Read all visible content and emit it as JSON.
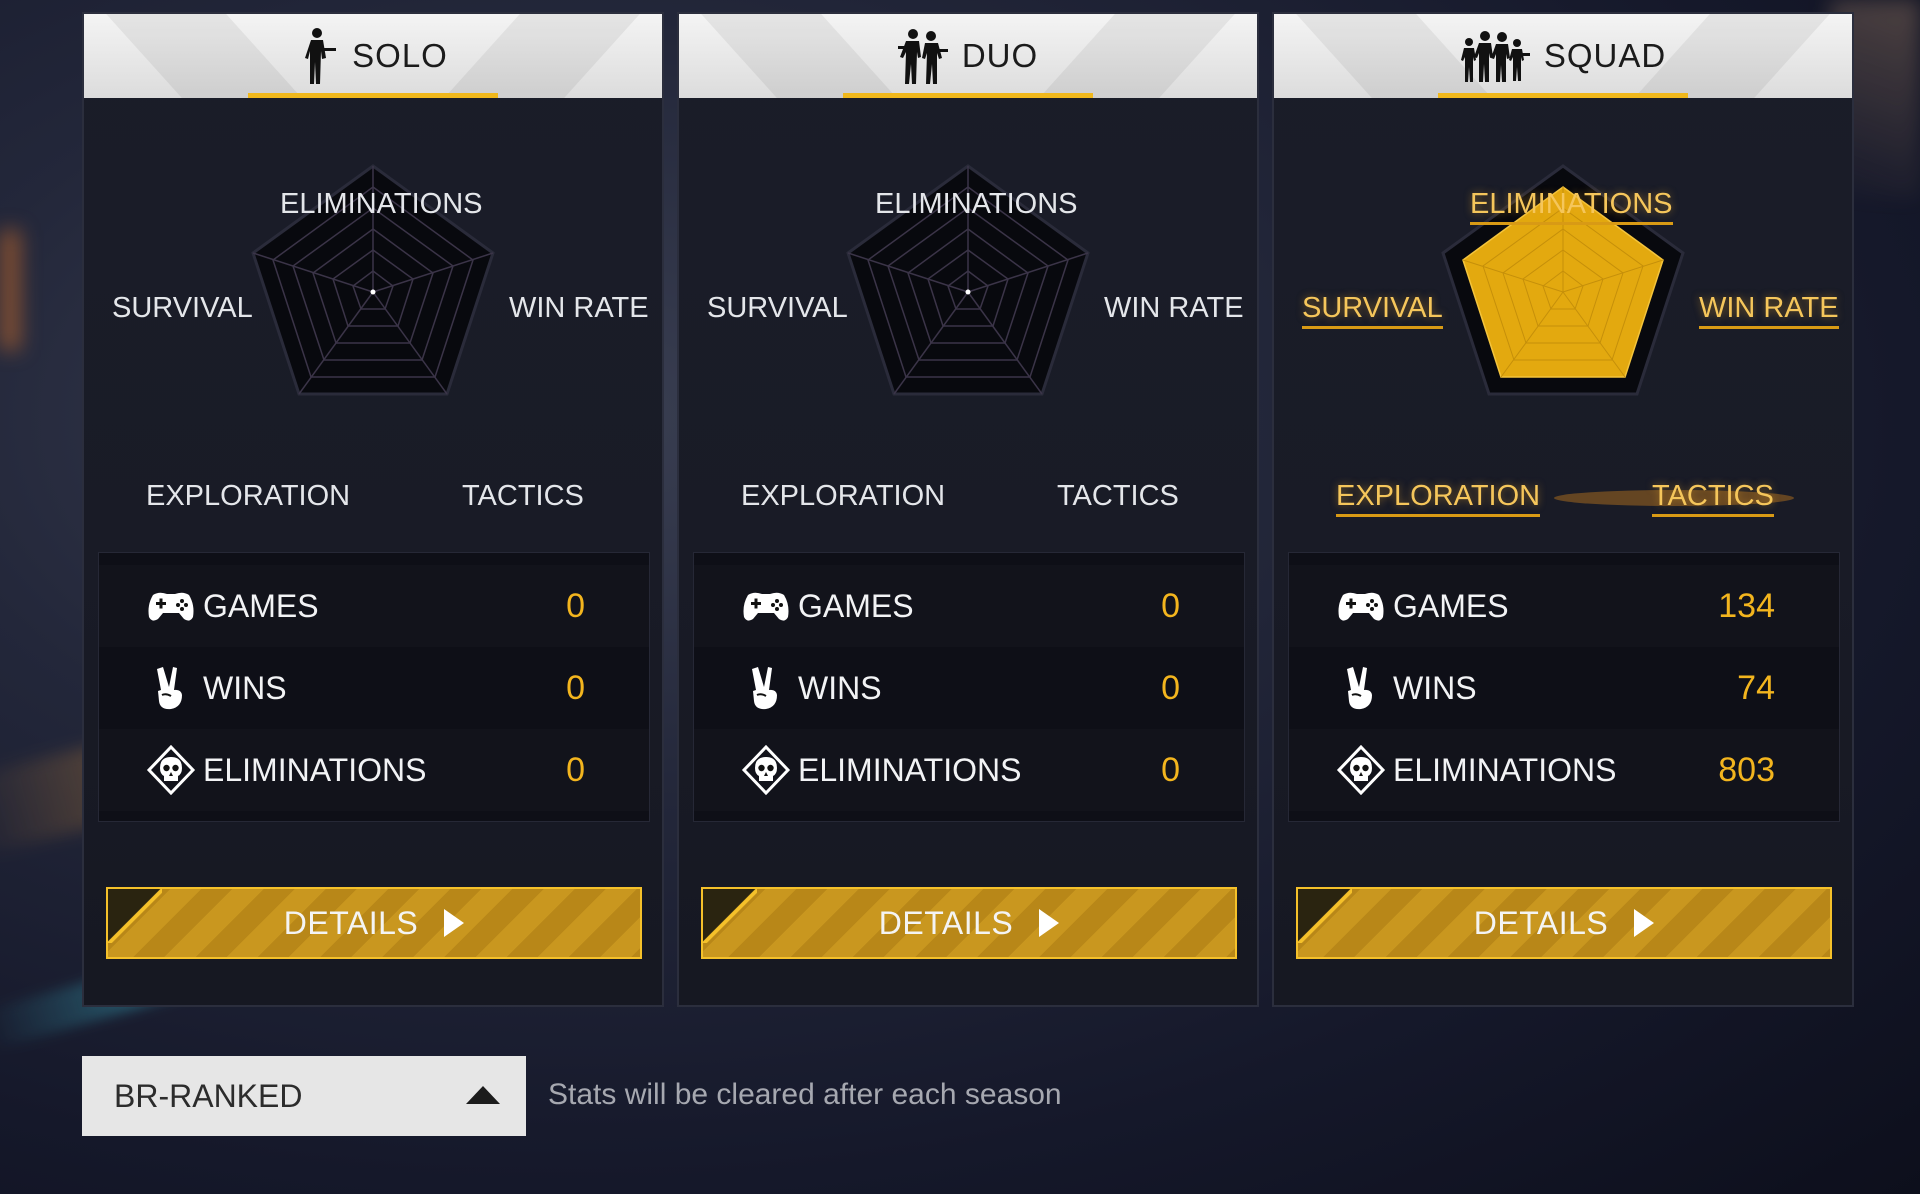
{
  "radar_labels": {
    "eliminations": "ELIMINATIONS",
    "survival": "SURVIVAL",
    "win_rate": "WIN RATE",
    "exploration": "EXPLORATION",
    "tactics": "TACTICS"
  },
  "stat_labels": {
    "games": "GAMES",
    "wins": "WINS",
    "eliminations": "ELIMINATIONS"
  },
  "details_label": "DETAILS",
  "modes": [
    {
      "title": "SOLO",
      "icon": "single-soldier-icon",
      "radar_filled": false,
      "stats": {
        "games": "0",
        "wins": "0",
        "eliminations": "0"
      }
    },
    {
      "title": "DUO",
      "icon": "two-soldiers-icon",
      "radar_filled": false,
      "stats": {
        "games": "0",
        "wins": "0",
        "eliminations": "0"
      }
    },
    {
      "title": "SQUAD",
      "icon": "four-soldiers-icon",
      "radar_filled": true,
      "stats": {
        "games": "134",
        "wins": "74",
        "eliminations": "803"
      }
    }
  ],
  "footer": {
    "mode_select": "BR-RANKED",
    "note": "Stats will be cleared after each season"
  },
  "colors": {
    "accent": "#f0b81c",
    "stat_value": "#f3b51e",
    "radar_fill": "#e3a90f",
    "header_bg": "#ececec"
  }
}
